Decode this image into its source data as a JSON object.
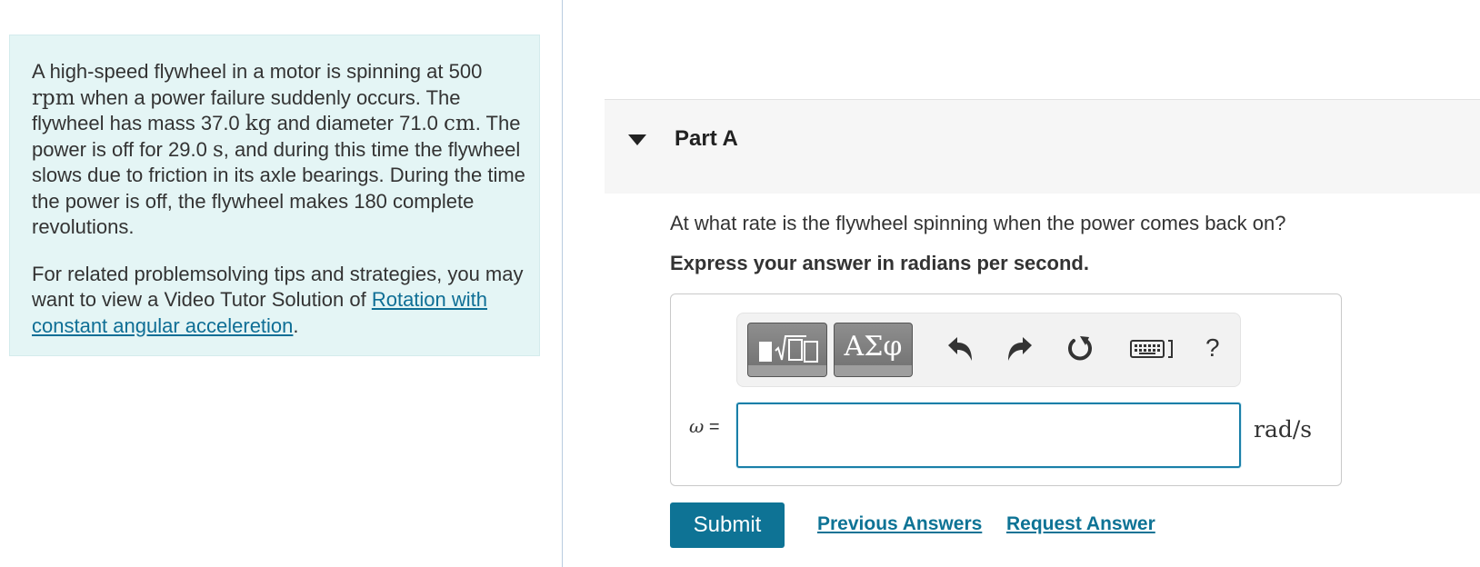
{
  "problem": {
    "p1": {
      "s1": "A high-speed flywheel in a motor is spinning at 500 ",
      "u1": "rpm",
      "s2": " when a power failure suddenly occurs. The flywheel has mass 37.0 ",
      "u2": "kg",
      "s3": " and diameter 71.0 ",
      "u3": "cm",
      "s4": ". The power is off for 29.0 ",
      "u4": "s",
      "s5": ", and during this time the flywheel slows due to friction in its axle bearings. During the time the power is off, the flywheel makes 180 complete revolutions."
    },
    "p2": {
      "text": "For related problemsolving tips and strategies, you may want to view a Video Tutor Solution of ",
      "link": "Rotation with constant angular acceleretion",
      "end": "."
    }
  },
  "part": {
    "title": "Part A",
    "question": "At what rate is the flywheel spinning when the power comes back on?",
    "instruction": "Express your answer in radians per second."
  },
  "toolbar": {
    "template_icon": "templates-icon",
    "symbol_label": "ΑΣφ",
    "undo_icon": "undo-icon",
    "redo_icon": "redo-icon",
    "reset_icon": "reset-icon",
    "keyboard_icon": "keyboard-icon",
    "help_label": "?"
  },
  "answer": {
    "variable": "ω",
    "equals": " =",
    "value": "",
    "unit": "rad/s"
  },
  "actions": {
    "submit": "Submit",
    "previous_answers": "Previous Answers",
    "request_answer": "Request Answer"
  },
  "colors": {
    "panel_bg": "#e4f5f5",
    "accent": "#0e7395",
    "input_border": "#1a7fa8",
    "toolbar_button": "#7a7a7a"
  }
}
